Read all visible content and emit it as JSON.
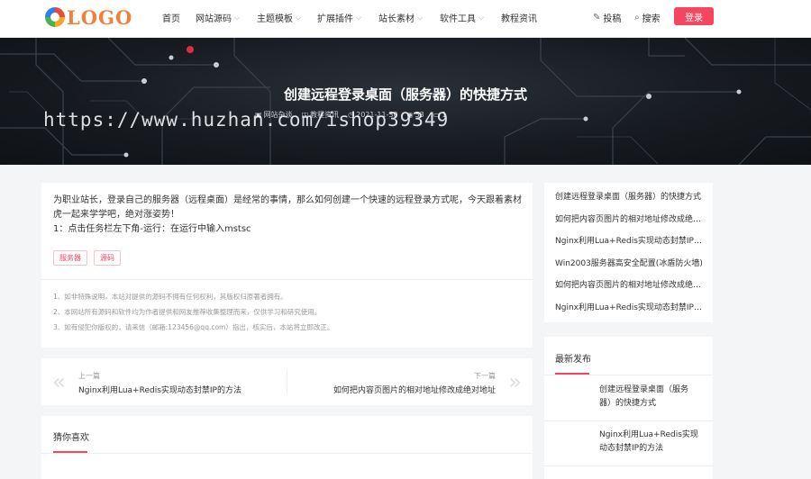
{
  "header": {
    "logo_text": "LOGO",
    "nav": [
      {
        "label": "首页",
        "has_dropdown": false
      },
      {
        "label": "网站源码",
        "has_dropdown": true
      },
      {
        "label": "主题模板",
        "has_dropdown": true
      },
      {
        "label": "扩展插件",
        "has_dropdown": true
      },
      {
        "label": "站长素材",
        "has_dropdown": true
      },
      {
        "label": "软件工具",
        "has_dropdown": true
      },
      {
        "label": "教程资讯",
        "has_dropdown": false
      }
    ],
    "contribute_label": "投稿",
    "search_label": "搜索",
    "login_label": "登录",
    "accent_color": "#f5455f"
  },
  "banner": {
    "title": "创建远程登录桌面（服务器）的快捷方式",
    "meta": {
      "category": "网站杂谈",
      "tag": "教程资讯",
      "date": "2021-11-30",
      "views": "53",
      "comments": "1"
    },
    "watermark": "https://www.huzhan.com/ishop39349"
  },
  "article": {
    "body_lines": [
      "为职业站长，登录自己的服务器（远程桌面）是经常的事情，那么如何创建一个快速的远程登录方式呢，今天跟着素材",
      "虎一起来学学吧，绝对涨姿势！",
      "1：点击任务栏左下角-运行：在运行中输入mstsc"
    ],
    "tags": [
      "服务器",
      "源码"
    ],
    "notices": [
      "1、如非特殊说明，本站对提供的源码不拥有任何权利，其版权归原著者拥有。",
      "2、本网站所有源码和软件均为作者提供和网友推荐收集整理而来，仅供学习和研究使用。",
      "3、如有侵犯你版权的，请来信（邮箱:123456@qq.com）指出，核实后，本站将立即改正。"
    ]
  },
  "prev_next": {
    "prev_label": "上一篇",
    "prev_title": "Nginx利用Lua+Redis实现动态封禁IP的方法",
    "next_label": "下一篇",
    "next_title": "如何把内容页图片的相对地址修改成绝对地址"
  },
  "guess": {
    "title": "猜你喜欢"
  },
  "sidebar": {
    "related": [
      "创建远程登录桌面（服务器）的快捷方式",
      "如何把内容页图片的相对地址修改成绝对地址",
      "Nginx利用Lua+Redis实现动态封禁IP的方法",
      "Win2003服务器高安全配置(冰盾防火墙)",
      "如何把内容页图片的相对地址修改成绝对地址",
      "Nginx利用Lua+Redis实现动态封禁IP的方法"
    ],
    "latest_title": "最新发布",
    "latest": [
      {
        "lines": [
          "创建远程登录桌面（服务",
          "器）的快捷方式"
        ]
      },
      {
        "lines": [
          "Nginx利用Lua+Redis实现",
          "动态封禁IP的方法"
        ]
      }
    ]
  }
}
